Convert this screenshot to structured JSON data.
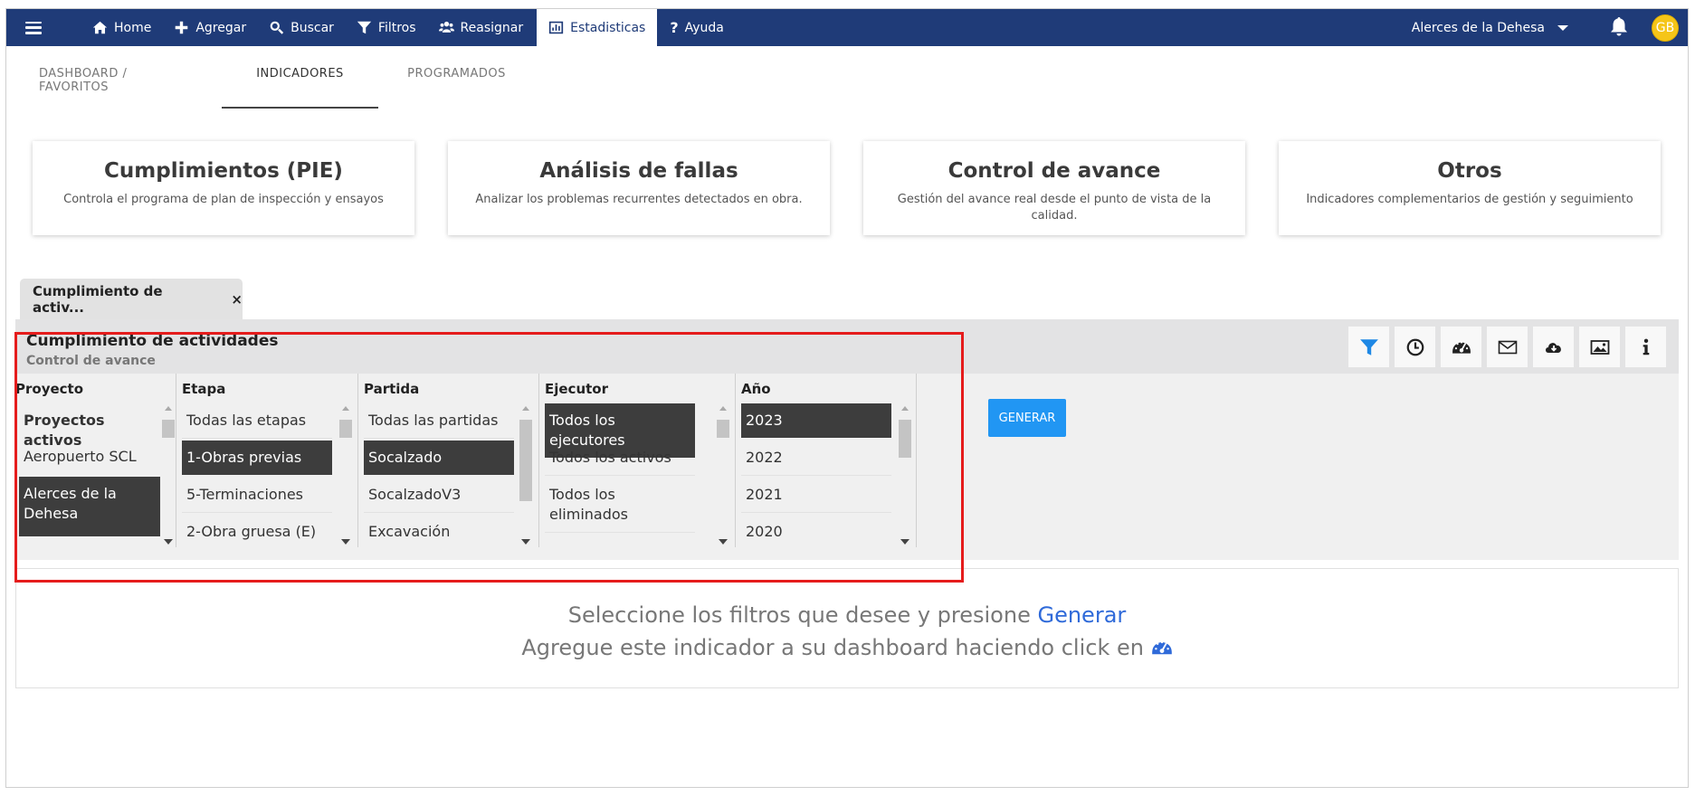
{
  "navbar": {
    "items": [
      {
        "label": "Home",
        "icon": "home-icon"
      },
      {
        "label": "Agregar",
        "icon": "plus-icon"
      },
      {
        "label": "Buscar",
        "icon": "search-icon"
      },
      {
        "label": "Filtros",
        "icon": "filter-icon"
      },
      {
        "label": "Reasignar",
        "icon": "users-icon"
      },
      {
        "label": "Estadisticas",
        "icon": "bar-chart-icon",
        "active": true
      },
      {
        "label": "Ayuda",
        "icon": "question-icon"
      }
    ],
    "project": "Alerces de la Dehesa",
    "avatar_initials": "GB",
    "color": "#1f3b78"
  },
  "subtabs": [
    {
      "label": "DASHBOARD / FAVORITOS"
    },
    {
      "label": "INDICADORES",
      "active": true
    },
    {
      "label": "PROGRAMADOS"
    }
  ],
  "cards": [
    {
      "title": "Cumplimientos (PIE)",
      "desc": "Controla el programa de plan de inspección y ensayos"
    },
    {
      "title": "Análisis de fallas",
      "desc": "Analizar los problemas recurrentes detectados en obra."
    },
    {
      "title": "Control de avance",
      "desc": "Gestión del avance real desde el punto de vista de la calidad."
    },
    {
      "title": "Otros",
      "desc": "Indicadores complementarios de gestión y seguimiento"
    }
  ],
  "indicator": {
    "tab_label": "Cumplimiento de activ...",
    "close": "×",
    "title": "Cumplimiento de actividades",
    "subtitle": "Control de avance",
    "tools": [
      "filter-icon",
      "clock-icon",
      "dashboard-icon",
      "envelope-icon",
      "cloud-download-icon",
      "image-icon",
      "info-icon"
    ]
  },
  "filters": {
    "proyecto": {
      "header": "Proyecto",
      "options": [
        "Proyectos activos",
        "Aeropuerto SCL",
        "Alerces de la Dehesa"
      ],
      "selected": "Alerces de la Dehesa"
    },
    "etapa": {
      "header": "Etapa",
      "options": [
        "Todas las etapas",
        "1-Obras previas",
        "5-Terminaciones",
        "2-Obra gruesa (E)"
      ],
      "selected": "1-Obras previas"
    },
    "partida": {
      "header": "Partida",
      "options": [
        "Todas las partidas",
        "Socalzado",
        "SocalzadoV3",
        "Excavación"
      ],
      "selected": "Socalzado"
    },
    "ejecutor": {
      "header": "Ejecutor",
      "options": [
        "Todos los ejecutores",
        "Todos los activos",
        "Todos los eliminados"
      ],
      "selected": "Todos los ejecutores"
    },
    "anio": {
      "header": "Año",
      "options": [
        "2023",
        "2022",
        "2021",
        "2020"
      ],
      "selected": "2023"
    },
    "generate_label": "GENERAR",
    "generate_color": "#2196f3"
  },
  "result": {
    "line1_prefix": "Seleccione los filtros que desee y presione ",
    "line1_link": "Generar",
    "line2": "Agregue este indicador a su dashboard haciendo click en"
  }
}
